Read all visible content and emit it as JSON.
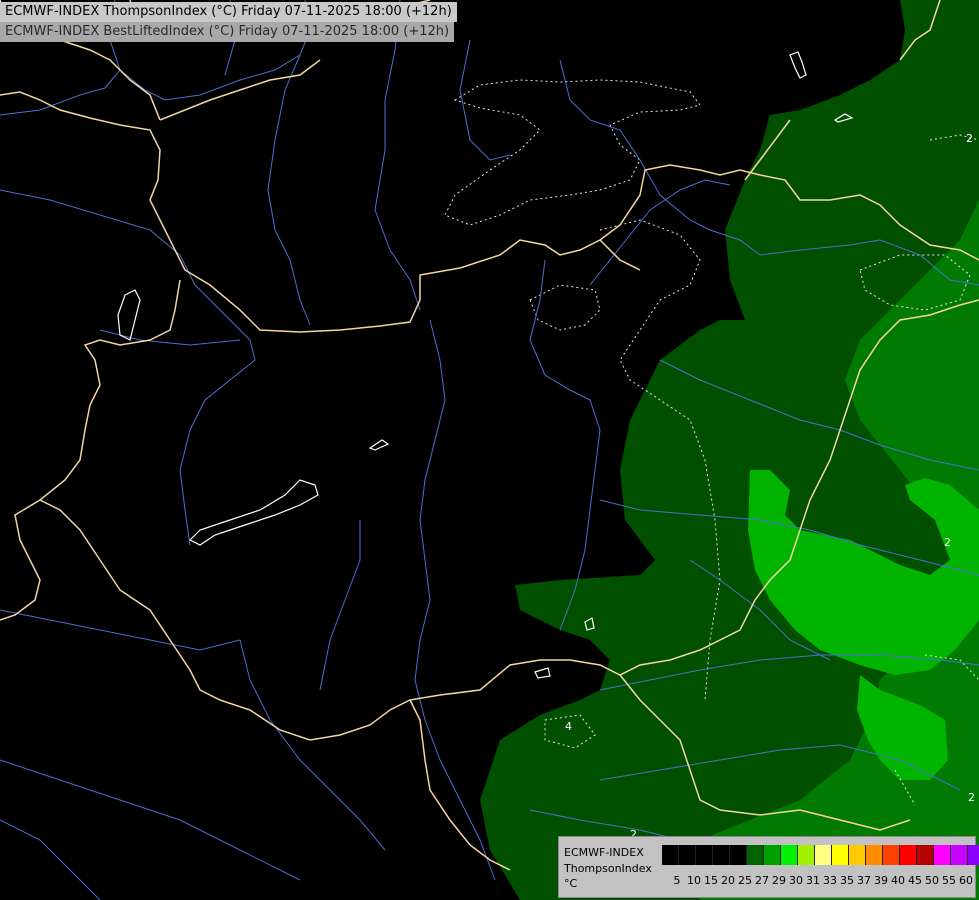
{
  "header": {
    "line1": "ECMWF-INDEX ThompsonIndex (°C) Friday 07-11-2025 18:00 (+12h)",
    "line2": "ECMWF-INDEX BestLiftedIndex (°C) Friday 07-11-2025 18:00 (+12h)"
  },
  "legend": {
    "model": "ECMWF-INDEX",
    "parameter": "ThompsonIndex",
    "unit": "°C",
    "colors": [
      "#000000",
      "#000000",
      "#000000",
      "#000000",
      "#000000",
      "#006400",
      "#00a000",
      "#00f000",
      "#a0f000",
      "#ffff80",
      "#ffff00",
      "#ffc800",
      "#ff8c00",
      "#ff4000",
      "#ff0000",
      "#b40000",
      "#ff00ff",
      "#c800ff",
      "#8c00ff",
      "#5000ff",
      "#0000ff"
    ],
    "ticks": [
      "5",
      "10",
      "15",
      "20",
      "25",
      "27",
      "29",
      "30",
      "31",
      "33",
      "35",
      "37",
      "39",
      "40",
      "45",
      "50",
      "55",
      "60"
    ]
  },
  "map": {
    "fill_colors": {
      "background": "#000000",
      "dark_green": "#005000",
      "mid_green": "#007a00",
      "light_green": "#00b400"
    },
    "border_color": "#f5d5a0",
    "river_color": "#4a6fd0",
    "contour_labels": [
      "2",
      "2",
      "2",
      "4",
      "2",
      "2"
    ]
  }
}
